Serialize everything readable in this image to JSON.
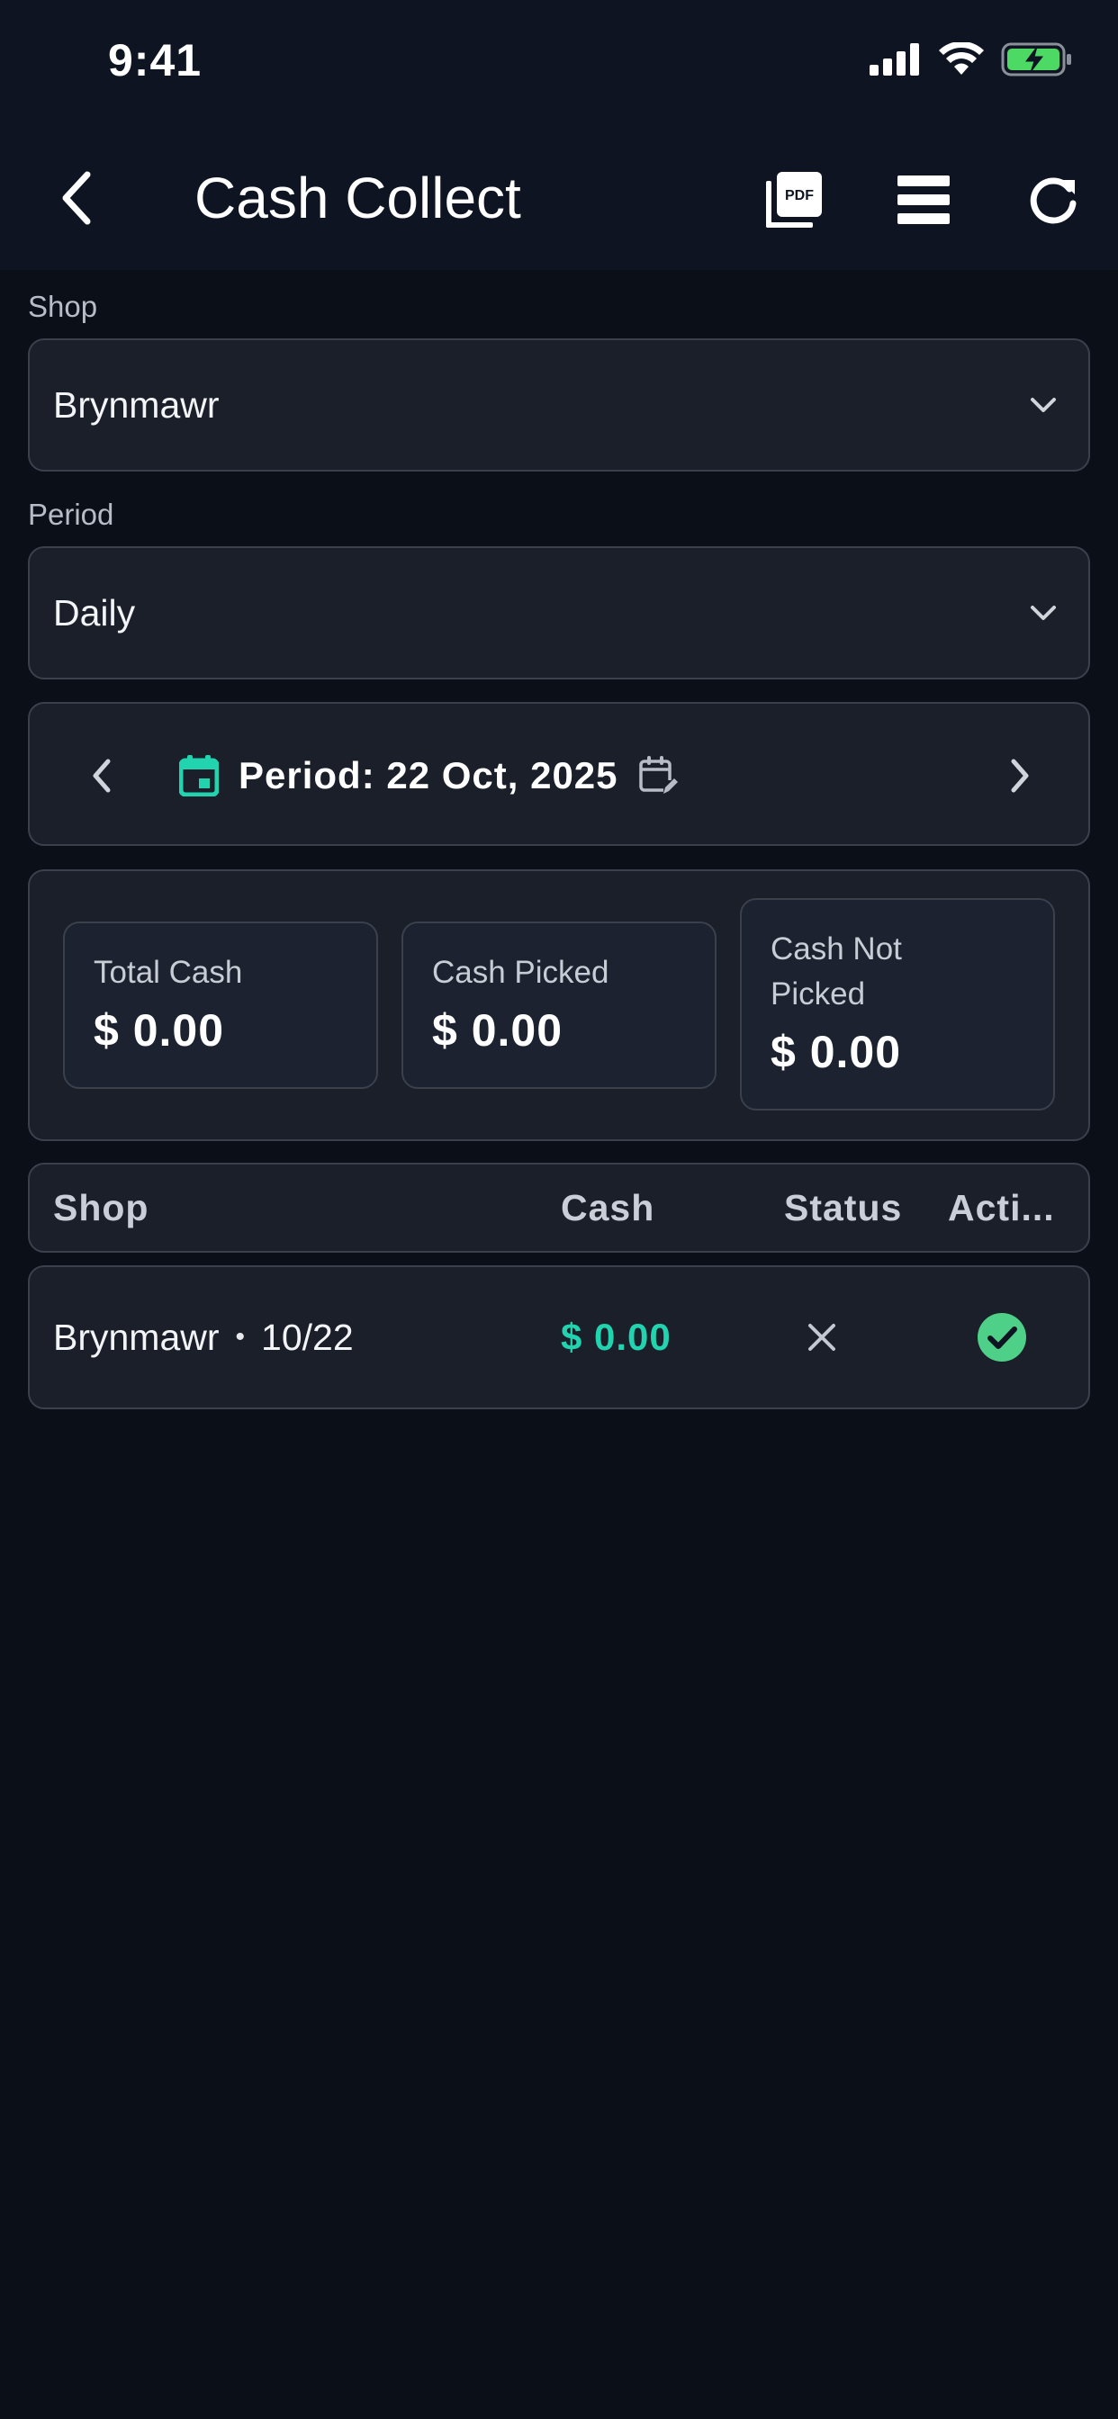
{
  "status_bar": {
    "time": "9:41"
  },
  "app_bar": {
    "title": "Cash Collect",
    "pdf_label": "PDF",
    "icons": [
      "back-chevron-icon",
      "pdf-icon",
      "menu-icon",
      "refresh-icon"
    ]
  },
  "filters": {
    "shop_label": "Shop",
    "shop_value": "Brynmawr",
    "period_label": "Period",
    "period_value": "Daily"
  },
  "period_nav": {
    "text": "Period: 22 Oct, 2025"
  },
  "summary": {
    "cards": [
      {
        "label": "Total Cash",
        "value": "$ 0.00"
      },
      {
        "label": "Cash Picked",
        "value": "$ 0.00"
      },
      {
        "label": "Cash Not Picked",
        "value": "$ 0.00"
      }
    ]
  },
  "table": {
    "columns": [
      "Shop",
      "Cash",
      "Status",
      "Acti..."
    ],
    "rows": [
      {
        "shop": "Brynmawr",
        "separator": "•",
        "date": "10/22",
        "cash": "$ 0.00",
        "status_icon": "close-icon",
        "action_icon": "check-circle-icon"
      }
    ]
  },
  "colors": {
    "background": "#0a0f18",
    "bar": "#0e1422",
    "panel": "#1a1f2a",
    "border": "#3a414d",
    "accent": "#22d3b0",
    "success": "#4fd089",
    "battery": "#4cd964"
  }
}
